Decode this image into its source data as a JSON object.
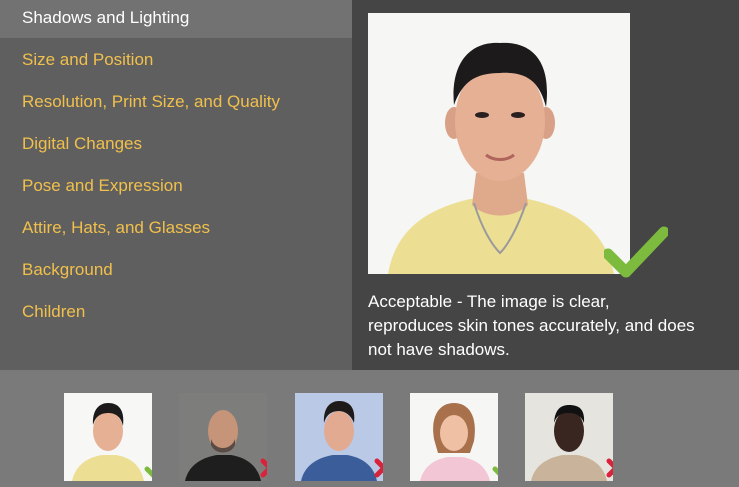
{
  "menu": {
    "items": [
      {
        "label": "Shadows and Lighting",
        "active": true
      },
      {
        "label": "Size and Position"
      },
      {
        "label": "Resolution, Print Size, and Quality"
      },
      {
        "label": "Digital Changes"
      },
      {
        "label": "Pose and Expression"
      },
      {
        "label": "Attire, Hats, and Glasses"
      },
      {
        "label": "Background"
      },
      {
        "label": "Children"
      }
    ]
  },
  "viewer": {
    "status_icon": "checkmark-icon",
    "caption": "Acceptable - The image is clear, reproduces skin tones accurately, and does not have shadows."
  },
  "thumbnails": [
    {
      "status": "acceptable",
      "icon": "checkmark-icon"
    },
    {
      "status": "unacceptable",
      "icon": "x-mark-icon"
    },
    {
      "status": "unacceptable",
      "icon": "x-mark-icon"
    },
    {
      "status": "acceptable",
      "icon": "checkmark-icon"
    },
    {
      "status": "unacceptable",
      "icon": "x-mark-icon"
    }
  ],
  "colors": {
    "accent": "#f1c04c",
    "check": "#7dbb3e",
    "cross": "#d9233a"
  }
}
